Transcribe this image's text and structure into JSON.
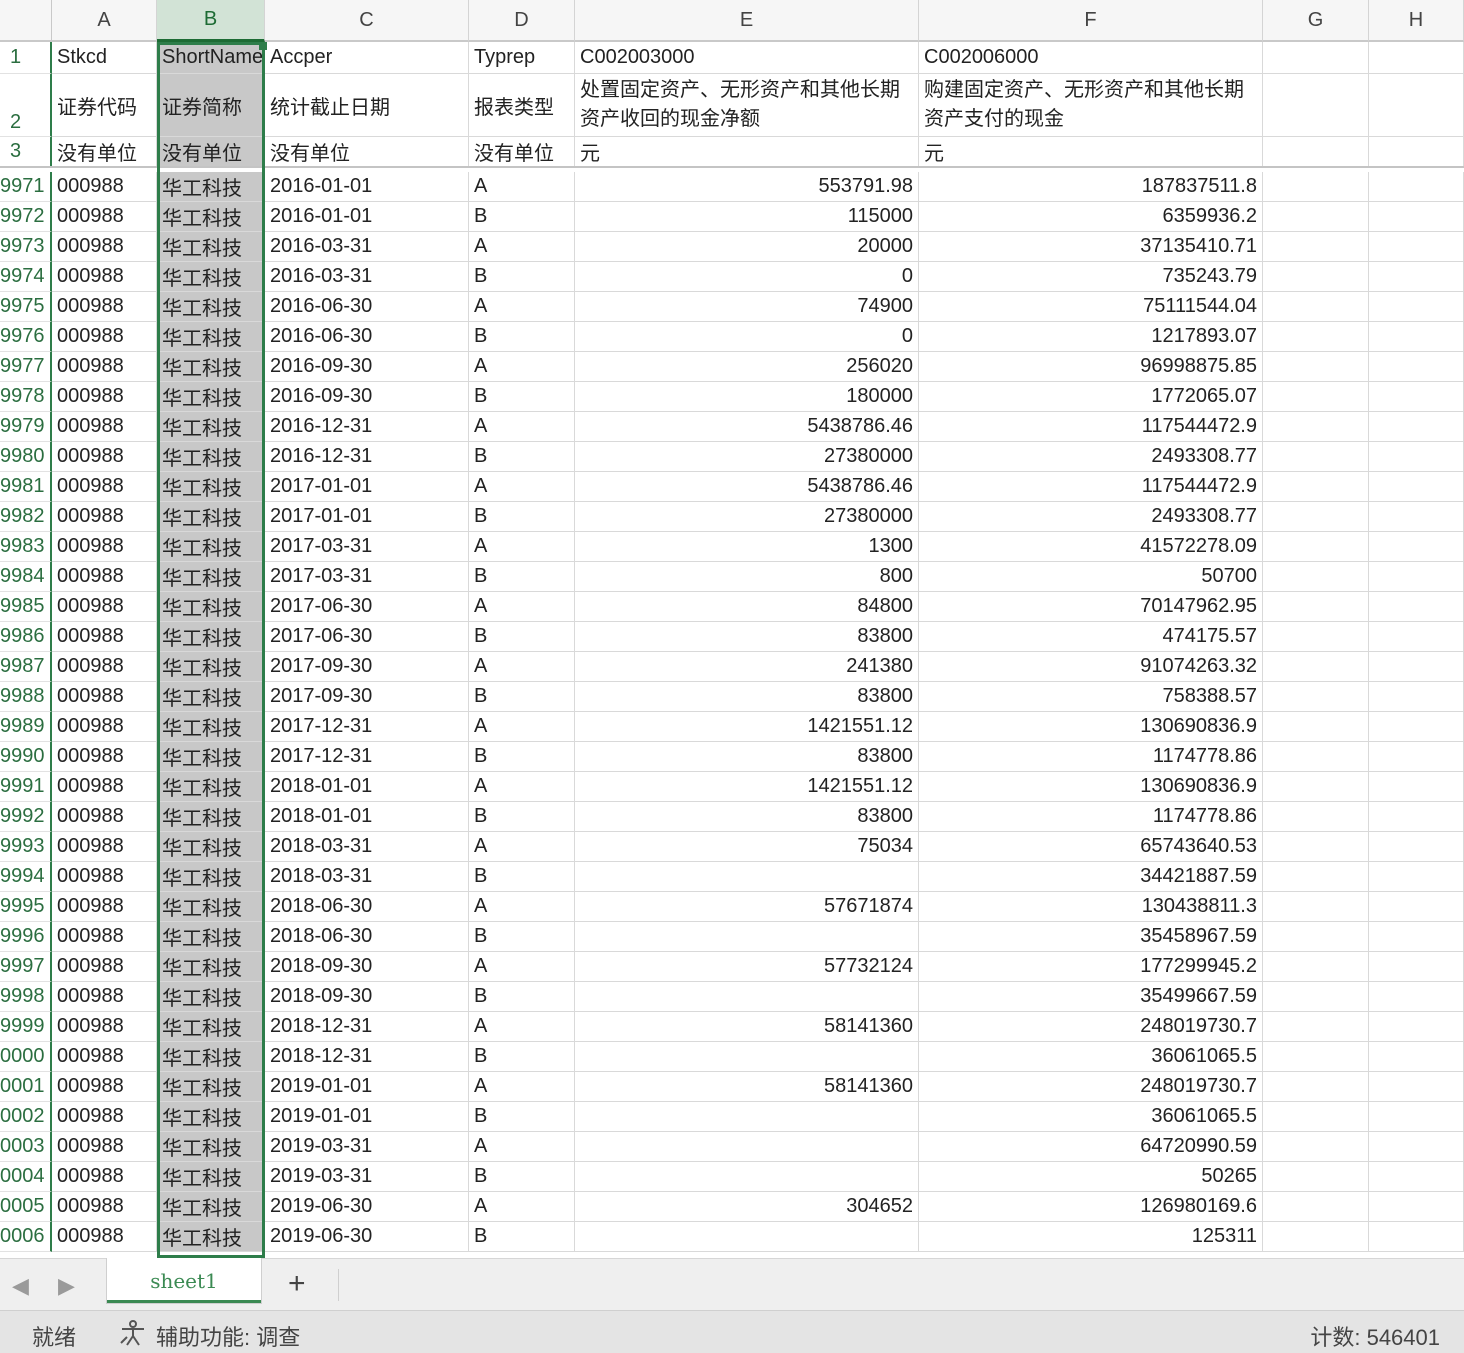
{
  "columns": [
    "A",
    "B",
    "C",
    "D",
    "E",
    "F",
    "G",
    "H"
  ],
  "selected_column": "B",
  "header_rows": [
    {
      "num": "1",
      "cells": [
        "Stkcd",
        "ShortName",
        "Accper",
        "Typrep",
        "C002003000",
        "C002006000",
        "",
        ""
      ]
    },
    {
      "num": "2",
      "cells": [
        "证券代码",
        "证券简称",
        "统计截止日期",
        "报表类型",
        "处置固定资产、无形资产和其他长期资产收回的现金净额",
        "购建固定资产、无形资产和其他长期资产支付的现金",
        "",
        ""
      ]
    },
    {
      "num": "3",
      "cells": [
        "没有单位",
        "没有单位",
        "没有单位",
        "没有单位",
        "元",
        "元",
        "",
        ""
      ]
    }
  ],
  "rows": [
    {
      "num": "9971",
      "a": "000988",
      "b": "华工科技",
      "c": "2016-01-01",
      "d": "A",
      "e": "553791.98",
      "f": "187837511.8"
    },
    {
      "num": "9972",
      "a": "000988",
      "b": "华工科技",
      "c": "2016-01-01",
      "d": "B",
      "e": "115000",
      "f": "6359936.2"
    },
    {
      "num": "9973",
      "a": "000988",
      "b": "华工科技",
      "c": "2016-03-31",
      "d": "A",
      "e": "20000",
      "f": "37135410.71"
    },
    {
      "num": "9974",
      "a": "000988",
      "b": "华工科技",
      "c": "2016-03-31",
      "d": "B",
      "e": "0",
      "f": "735243.79"
    },
    {
      "num": "9975",
      "a": "000988",
      "b": "华工科技",
      "c": "2016-06-30",
      "d": "A",
      "e": "74900",
      "f": "75111544.04"
    },
    {
      "num": "9976",
      "a": "000988",
      "b": "华工科技",
      "c": "2016-06-30",
      "d": "B",
      "e": "0",
      "f": "1217893.07"
    },
    {
      "num": "9977",
      "a": "000988",
      "b": "华工科技",
      "c": "2016-09-30",
      "d": "A",
      "e": "256020",
      "f": "96998875.85"
    },
    {
      "num": "9978",
      "a": "000988",
      "b": "华工科技",
      "c": "2016-09-30",
      "d": "B",
      "e": "180000",
      "f": "1772065.07"
    },
    {
      "num": "9979",
      "a": "000988",
      "b": "华工科技",
      "c": "2016-12-31",
      "d": "A",
      "e": "5438786.46",
      "f": "117544472.9"
    },
    {
      "num": "9980",
      "a": "000988",
      "b": "华工科技",
      "c": "2016-12-31",
      "d": "B",
      "e": "27380000",
      "f": "2493308.77"
    },
    {
      "num": "9981",
      "a": "000988",
      "b": "华工科技",
      "c": "2017-01-01",
      "d": "A",
      "e": "5438786.46",
      "f": "117544472.9"
    },
    {
      "num": "9982",
      "a": "000988",
      "b": "华工科技",
      "c": "2017-01-01",
      "d": "B",
      "e": "27380000",
      "f": "2493308.77"
    },
    {
      "num": "9983",
      "a": "000988",
      "b": "华工科技",
      "c": "2017-03-31",
      "d": "A",
      "e": "1300",
      "f": "41572278.09"
    },
    {
      "num": "9984",
      "a": "000988",
      "b": "华工科技",
      "c": "2017-03-31",
      "d": "B",
      "e": "800",
      "f": "50700"
    },
    {
      "num": "9985",
      "a": "000988",
      "b": "华工科技",
      "c": "2017-06-30",
      "d": "A",
      "e": "84800",
      "f": "70147962.95"
    },
    {
      "num": "9986",
      "a": "000988",
      "b": "华工科技",
      "c": "2017-06-30",
      "d": "B",
      "e": "83800",
      "f": "474175.57"
    },
    {
      "num": "9987",
      "a": "000988",
      "b": "华工科技",
      "c": "2017-09-30",
      "d": "A",
      "e": "241380",
      "f": "91074263.32"
    },
    {
      "num": "9988",
      "a": "000988",
      "b": "华工科技",
      "c": "2017-09-30",
      "d": "B",
      "e": "83800",
      "f": "758388.57"
    },
    {
      "num": "9989",
      "a": "000988",
      "b": "华工科技",
      "c": "2017-12-31",
      "d": "A",
      "e": "1421551.12",
      "f": "130690836.9"
    },
    {
      "num": "9990",
      "a": "000988",
      "b": "华工科技",
      "c": "2017-12-31",
      "d": "B",
      "e": "83800",
      "f": "1174778.86"
    },
    {
      "num": "9991",
      "a": "000988",
      "b": "华工科技",
      "c": "2018-01-01",
      "d": "A",
      "e": "1421551.12",
      "f": "130690836.9"
    },
    {
      "num": "9992",
      "a": "000988",
      "b": "华工科技",
      "c": "2018-01-01",
      "d": "B",
      "e": "83800",
      "f": "1174778.86"
    },
    {
      "num": "9993",
      "a": "000988",
      "b": "华工科技",
      "c": "2018-03-31",
      "d": "A",
      "e": "75034",
      "f": "65743640.53"
    },
    {
      "num": "9994",
      "a": "000988",
      "b": "华工科技",
      "c": "2018-03-31",
      "d": "B",
      "e": "",
      "f": "34421887.59"
    },
    {
      "num": "9995",
      "a": "000988",
      "b": "华工科技",
      "c": "2018-06-30",
      "d": "A",
      "e": "57671874",
      "f": "130438811.3"
    },
    {
      "num": "9996",
      "a": "000988",
      "b": "华工科技",
      "c": "2018-06-30",
      "d": "B",
      "e": "",
      "f": "35458967.59"
    },
    {
      "num": "9997",
      "a": "000988",
      "b": "华工科技",
      "c": "2018-09-30",
      "d": "A",
      "e": "57732124",
      "f": "177299945.2"
    },
    {
      "num": "9998",
      "a": "000988",
      "b": "华工科技",
      "c": "2018-09-30",
      "d": "B",
      "e": "",
      "f": "35499667.59"
    },
    {
      "num": "9999",
      "a": "000988",
      "b": "华工科技",
      "c": "2018-12-31",
      "d": "A",
      "e": "58141360",
      "f": "248019730.7"
    },
    {
      "num": "0000",
      "a": "000988",
      "b": "华工科技",
      "c": "2018-12-31",
      "d": "B",
      "e": "",
      "f": "36061065.5"
    },
    {
      "num": "0001",
      "a": "000988",
      "b": "华工科技",
      "c": "2019-01-01",
      "d": "A",
      "e": "58141360",
      "f": "248019730.7"
    },
    {
      "num": "0002",
      "a": "000988",
      "b": "华工科技",
      "c": "2019-01-01",
      "d": "B",
      "e": "",
      "f": "36061065.5"
    },
    {
      "num": "0003",
      "a": "000988",
      "b": "华工科技",
      "c": "2019-03-31",
      "d": "A",
      "e": "",
      "f": "64720990.59"
    },
    {
      "num": "0004",
      "a": "000988",
      "b": "华工科技",
      "c": "2019-03-31",
      "d": "B",
      "e": "",
      "f": "50265"
    },
    {
      "num": "0005",
      "a": "000988",
      "b": "华工科技",
      "c": "2019-06-30",
      "d": "A",
      "e": "304652",
      "f": "126980169.6"
    },
    {
      "num": "0006",
      "a": "000988",
      "b": "华工科技",
      "c": "2019-06-30",
      "d": "B",
      "e": "",
      "f": "125311"
    }
  ],
  "sheet_tabs": [
    "sheet1"
  ],
  "add_sheet_label": "+",
  "status": {
    "ready": "就绪",
    "accessibility": "辅助功能: 调查",
    "count": "计数: 546401"
  },
  "colors": {
    "accent": "#2e7d4a",
    "selected_column_fill": "#c8c8c8",
    "selected_header_fill": "#d2e3d6"
  }
}
